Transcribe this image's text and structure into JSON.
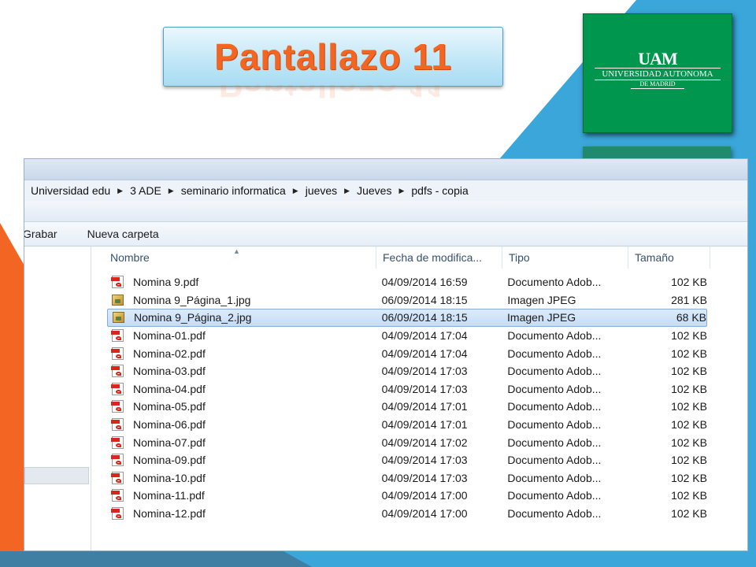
{
  "slide": {
    "title": "Pantallazo 11",
    "logo": {
      "mark": "UAM",
      "line1": "UNIVERSIDAD AUTONOMA",
      "line2": "DE MADRID"
    },
    "colors": {
      "accent_orange": "#f26522",
      "accent_blue": "#3aa6d9",
      "logo_green": "#00964d"
    }
  },
  "explorer": {
    "breadcrumb": [
      "Universidad edu",
      "3 ADE",
      "seminario informatica",
      "jueves",
      "Jueves",
      "pdfs - copia"
    ],
    "toolbar": {
      "grabar_label": "Grabar",
      "nueva_carpeta_label": "Nueva carpeta"
    },
    "columns": {
      "name": "Nombre",
      "date": "Fecha de modifica...",
      "type": "Tipo",
      "size": "Tamaño"
    },
    "files": [
      {
        "icon": "pdf-file-icon",
        "name": "Nomina 9.pdf",
        "date": "04/09/2014 16:59",
        "type": "Documento Adob...",
        "size": "102 KB",
        "selected": false
      },
      {
        "icon": "jpg-file-icon",
        "name": "Nomina 9_Página_1.jpg",
        "date": "06/09/2014 18:15",
        "type": "Imagen JPEG",
        "size": "281 KB",
        "selected": false
      },
      {
        "icon": "jpg-file-icon",
        "name": "Nomina 9_Página_2.jpg",
        "date": "06/09/2014 18:15",
        "type": "Imagen JPEG",
        "size": "68 KB",
        "selected": true
      },
      {
        "icon": "pdf-file-icon",
        "name": "Nomina-01.pdf",
        "date": "04/09/2014 17:04",
        "type": "Documento Adob...",
        "size": "102 KB",
        "selected": false
      },
      {
        "icon": "pdf-file-icon",
        "name": "Nomina-02.pdf",
        "date": "04/09/2014 17:04",
        "type": "Documento Adob...",
        "size": "102 KB",
        "selected": false
      },
      {
        "icon": "pdf-file-icon",
        "name": "Nomina-03.pdf",
        "date": "04/09/2014 17:03",
        "type": "Documento Adob...",
        "size": "102 KB",
        "selected": false
      },
      {
        "icon": "pdf-file-icon",
        "name": "Nomina-04.pdf",
        "date": "04/09/2014 17:03",
        "type": "Documento Adob...",
        "size": "102 KB",
        "selected": false
      },
      {
        "icon": "pdf-file-icon",
        "name": "Nomina-05.pdf",
        "date": "04/09/2014 17:01",
        "type": "Documento Adob...",
        "size": "102 KB",
        "selected": false
      },
      {
        "icon": "pdf-file-icon",
        "name": "Nomina-06.pdf",
        "date": "04/09/2014 17:01",
        "type": "Documento Adob...",
        "size": "102 KB",
        "selected": false
      },
      {
        "icon": "pdf-file-icon",
        "name": "Nomina-07.pdf",
        "date": "04/09/2014 17:02",
        "type": "Documento Adob...",
        "size": "102 KB",
        "selected": false
      },
      {
        "icon": "pdf-file-icon",
        "name": "Nomina-09.pdf",
        "date": "04/09/2014 17:03",
        "type": "Documento Adob...",
        "size": "102 KB",
        "selected": false
      },
      {
        "icon": "pdf-file-icon",
        "name": "Nomina-10.pdf",
        "date": "04/09/2014 17:03",
        "type": "Documento Adob...",
        "size": "102 KB",
        "selected": false
      },
      {
        "icon": "pdf-file-icon",
        "name": "Nomina-11.pdf",
        "date": "04/09/2014 17:00",
        "type": "Documento Adob...",
        "size": "102 KB",
        "selected": false
      },
      {
        "icon": "pdf-file-icon",
        "name": "Nomina-12.pdf",
        "date": "04/09/2014 17:00",
        "type": "Documento Adob...",
        "size": "102 KB",
        "selected": false
      }
    ]
  }
}
